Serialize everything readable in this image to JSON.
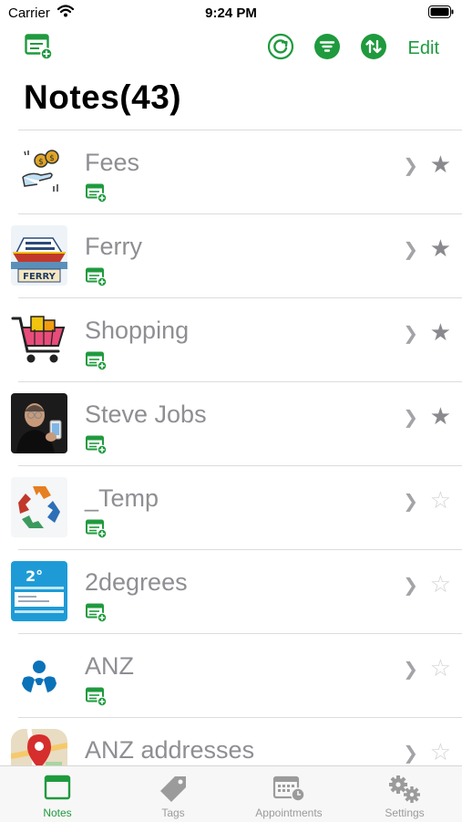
{
  "status_bar": {
    "carrier": "Carrier",
    "time": "9:24 PM"
  },
  "toolbar": {
    "edit_label": "Edit"
  },
  "page": {
    "title": "Notes(43)"
  },
  "colors": {
    "accent": "#1f9a3e",
    "row_title": "#8e8e93",
    "star_on": "#8a8a8e",
    "star_off": "#d2d2d6"
  },
  "notes": [
    {
      "title": "Fees",
      "starred": true,
      "thumb_icon": "money-hand-icon"
    },
    {
      "title": "Ferry",
      "starred": true,
      "thumb_icon": "ferry-icon",
      "thumb_text": "FERRY"
    },
    {
      "title": "Shopping",
      "starred": true,
      "thumb_icon": "shopping-cart-icon"
    },
    {
      "title": "Steve Jobs",
      "starred": true,
      "thumb_icon": "person-photo-icon"
    },
    {
      "title": "_Temp",
      "starred": false,
      "thumb_icon": "recycle-icon"
    },
    {
      "title": "2degrees",
      "starred": false,
      "thumb_icon": "document-card-icon",
      "thumb_text": "2°"
    },
    {
      "title": "ANZ",
      "starred": false,
      "thumb_icon": "anz-logo-icon"
    },
    {
      "title": "ANZ addresses",
      "starred": false,
      "thumb_icon": "map-pin-icon"
    }
  ],
  "tabs": [
    {
      "label": "Notes",
      "icon": "notes-window-icon",
      "active": true
    },
    {
      "label": "Tags",
      "icon": "tag-icon",
      "active": false
    },
    {
      "label": "Appointments",
      "icon": "calendar-clock-icon",
      "active": false
    },
    {
      "label": "Settings",
      "icon": "gears-icon",
      "active": false
    }
  ]
}
